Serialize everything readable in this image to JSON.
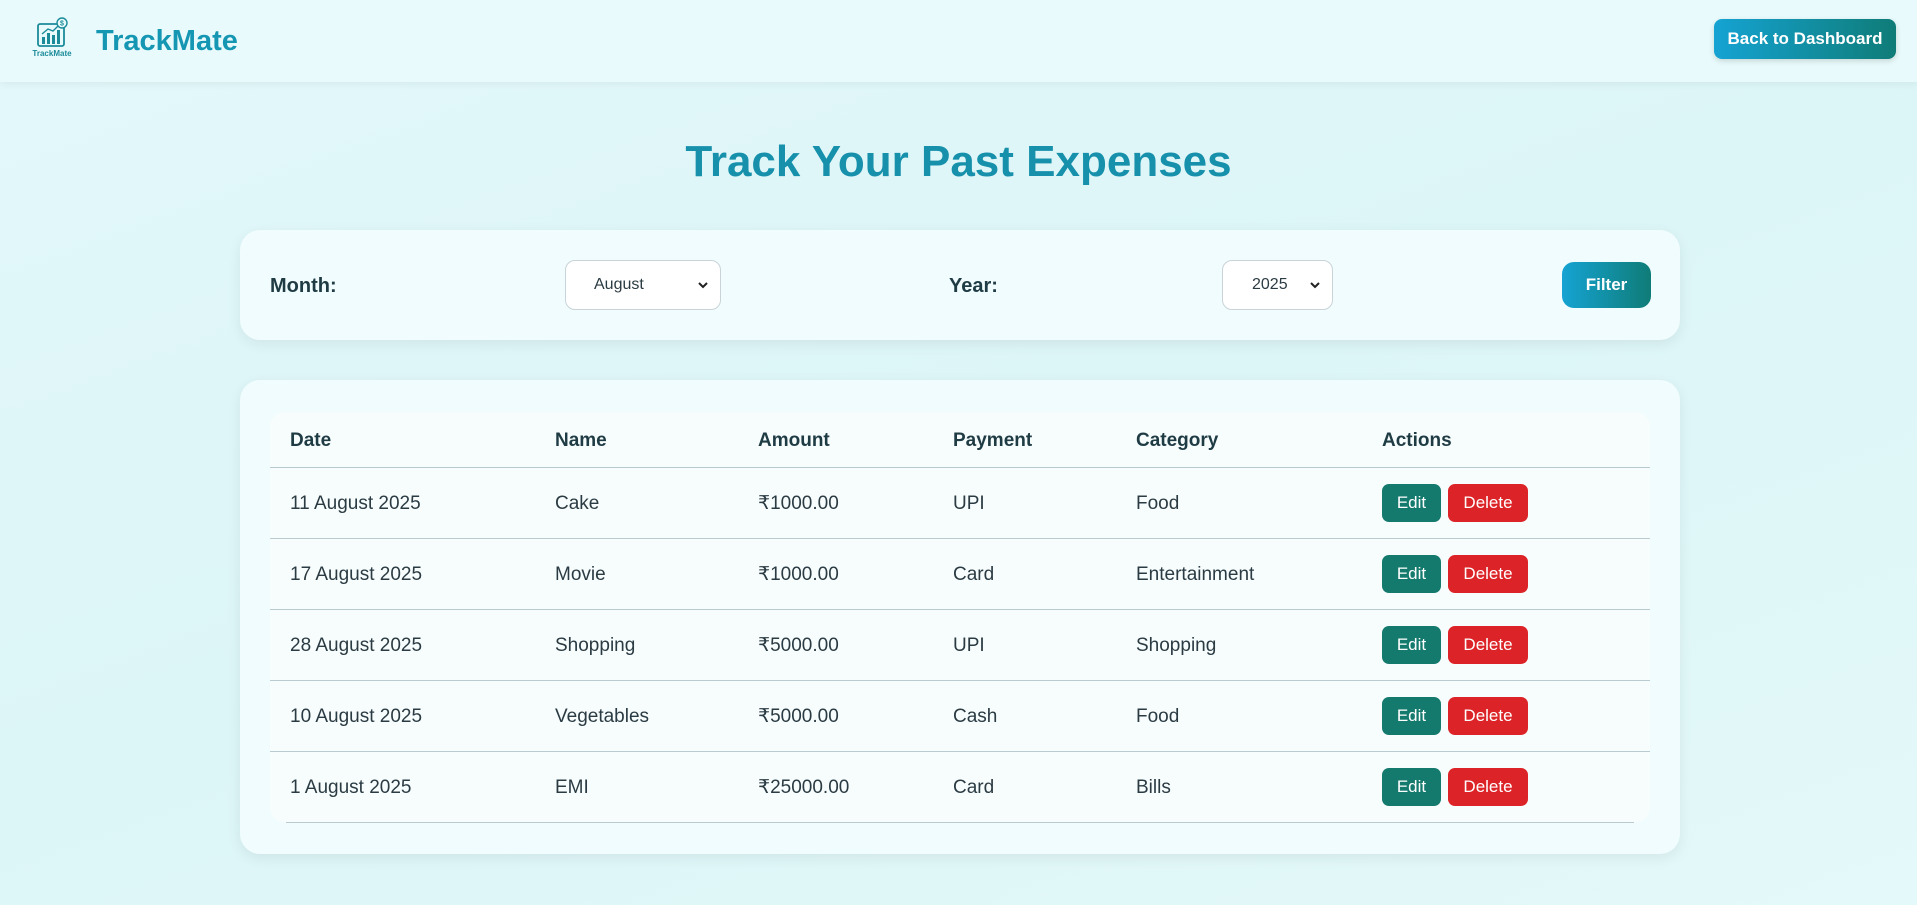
{
  "header": {
    "brand": "TrackMate",
    "logo_caption": "TrackMate",
    "back_button": "Back to Dashboard"
  },
  "page_title": "Track Your Past Expenses",
  "filter": {
    "month_label": "Month:",
    "month_value": "August",
    "year_label": "Year:",
    "year_value": "2025",
    "filter_button": "Filter"
  },
  "table": {
    "headers": [
      "Date",
      "Name",
      "Amount",
      "Payment",
      "Category",
      "Actions"
    ],
    "rows": [
      {
        "date": "11 August 2025",
        "name": "Cake",
        "amount": "₹1000.00",
        "payment": "UPI",
        "category": "Food"
      },
      {
        "date": "17 August 2025",
        "name": "Movie",
        "amount": "₹1000.00",
        "payment": "Card",
        "category": "Entertainment"
      },
      {
        "date": "28 August 2025",
        "name": "Shopping",
        "amount": "₹5000.00",
        "payment": "UPI",
        "category": "Shopping"
      },
      {
        "date": "10 August 2025",
        "name": "Vegetables",
        "amount": "₹5000.00",
        "payment": "Cash",
        "category": "Food"
      },
      {
        "date": "1 August 2025",
        "name": "EMI",
        "amount": "₹25000.00",
        "payment": "Card",
        "category": "Bills"
      }
    ],
    "edit_label": "Edit",
    "delete_label": "Delete"
  },
  "colors": {
    "brand": "#1596b3",
    "accent_gradient_start": "#15a3d3",
    "accent_gradient_end": "#0f7c77",
    "edit": "#157a6e",
    "delete": "#dc2327"
  },
  "icons": {
    "logo": "bar-chart-dollar-icon",
    "select_arrow": "chevron-down-icon"
  }
}
